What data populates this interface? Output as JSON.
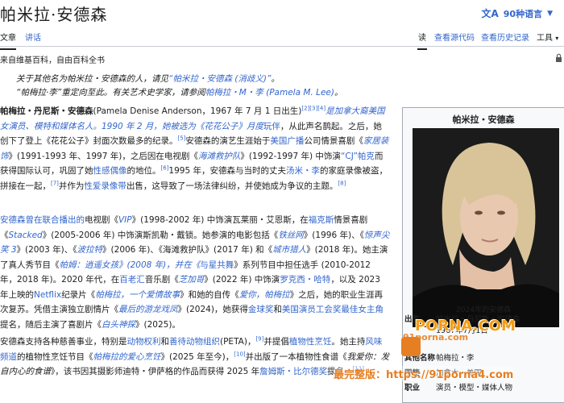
{
  "header": {
    "title": "帕米拉·安德森",
    "languages_label": "90种语言"
  },
  "tabs": {
    "article": "文章",
    "talk": "讲话",
    "read": "读",
    "view_source": "查看源代码",
    "view_history": "查看历史记录",
    "tools": "工具"
  },
  "tagline": "来自维基百科，自由百科全书",
  "hatnote": {
    "line1_pre": "关于其他名为帕米拉・安德森的人，请见",
    "line1_link": "“帕米拉・安德森 (消歧义)”",
    "line1_post": "。",
    "line2_pre": "“帕梅拉·李”重定向至此。有关艺术史学家，请参阅",
    "line2_link": "帕梅拉・M・李 (Pamela M. Lee)",
    "line2_post": "。"
  },
  "p1": {
    "t1": "帕梅拉・丹尼斯・安德森",
    "t2": "(Pamela Denise Anderson，1967 年 7 月 1 日出生)",
    "c1": "[2][3][4]",
    "t3": "是加拿大裔美国女演员、模特和媒体名人。1990 年 2 月，她被选为《花花公子》月度",
    "t4": "玩伴",
    "t5": "，从此声名鹊起。之后，她创下了登上《花花公子》封面次数最多的纪录。",
    "c2": "[5]",
    "t6": "安德森的演艺生涯始于",
    "t7": "美国广播",
    "t8": "公司情景喜剧《",
    "t9": "家居装饰",
    "t10": "》(1991-1993 年、1997 年)，之后因在电视剧《",
    "t11": "海滩救护队",
    "t12": "》(1992-1997 年) 中饰演",
    "t13": "“CJ”帕克",
    "t14": "而获得国际认可，巩固了她",
    "t15": "性感偶像",
    "t16": "的地位。",
    "c3": "[6]",
    "t17": "1995 年，安德森与当时的丈夫",
    "t18": "汤米・李",
    "t19": "的家庭录像被盗，拼接在一起，",
    "c4": "[7]",
    "t20": "并作为",
    "t21": "性爱录像带",
    "t22": "出售，这导致了一场法律纠纷，并使她成为争议的主题。",
    "c5": "[8]"
  },
  "p2": {
    "t1": "安德森曾在联合播出的",
    "t2": "电视剧《",
    "t3": "VIP",
    "t4": "》(1998-2002 年) 中饰演瓦莱丽・艾恩斯，在",
    "t5": "福克斯",
    "t6": "情景喜剧《",
    "t7": "Stacked",
    "t8": "》(2005-2006 年) 中饰演斯凯勒・戴锁。她参演的电影包括《",
    "t9": "铁丝网",
    "t10": "》(1996 年)、《",
    "t11": "惊声尖笑 3",
    "t12": "》(2003 年)、《",
    "t13": "波拉特",
    "t14": "》(2006 年)、《海滩救护队》(2017 年) 和《",
    "t15": "城市猎人",
    "t16": "》(2018 年)。她主演了真人秀节目《",
    "t17": "帕姆：逍遥女孩",
    "t18": "》(2008 年)，并在《",
    "t19": "与星共舞",
    "t20": "》系列节目中担任选手 (2010-2012 年，2018 年)。2020 年代，在",
    "t21": "百老汇",
    "t22": "音乐剧《",
    "t23": "芝加哥",
    "t24": "》(2022 年) 中饰演",
    "t25": "罗克西・哈特",
    "t26": "，以及 2023 年上映的",
    "t27": "Netflix",
    "t28": "纪录片《",
    "t29": "帕梅拉，一个爱情故事",
    "t30": "》和她的自传《",
    "t31": "爱你，帕梅拉",
    "t32": "》之后，她的职业生涯再次复苏。凭借主演独立剧情片《",
    "t33": "最后的游龙戏凤",
    "t34": "》(2024)，她获得",
    "t35": "金球奖",
    "t36": "和",
    "t37": "美国演员工会奖最佳女主角",
    "t38": "提名，随后主演了喜剧片《",
    "t39": "白头神探",
    "t40": "》(2025)。"
  },
  "p3": {
    "t1": "安德森支持各种慈善事业，特别是",
    "t2": "动物权利",
    "t3": "和",
    "t4": "善待动物组织",
    "t5": "(PETA)，",
    "c1": "[9]",
    "t6": "并提倡",
    "t7": "植物性烹饪",
    "t8": "。她主持",
    "t9": "风味频道",
    "t10": "的植物性烹饪节目《",
    "t11": "帕梅拉的爱心烹饪",
    "t12": "》(2025 年至今)，",
    "c2": "[10]",
    "t13": "并出版了一本植物性食谱《",
    "t14": "我爱你：发自内心的食谱",
    "t15": "》，该书因其摄影师迪特・伊萨格的作品而获得 2025 年",
    "t16": "詹姆斯・比尔德奖",
    "t17": "提名。",
    "c3": "[11]"
  },
  "infobox": {
    "title": "帕米拉・安德森",
    "caption": "2024年的安德森",
    "rows": [
      {
        "label": "出生",
        "value": "帕米拉・丹尼斯・安德森\n1967年7月1日"
      },
      {
        "label": "其他名称",
        "value": "帕梅拉・李"
      },
      {
        "label": "国籍",
        "value": "加拿大・美国"
      },
      {
        "label": "职业",
        "value": "演员・模型・媒体人物"
      }
    ]
  },
  "watermark": {
    "main": "PORNA.COM",
    "sub": "91porna.com",
    "url": "最完整版：https://91porna4.com"
  }
}
